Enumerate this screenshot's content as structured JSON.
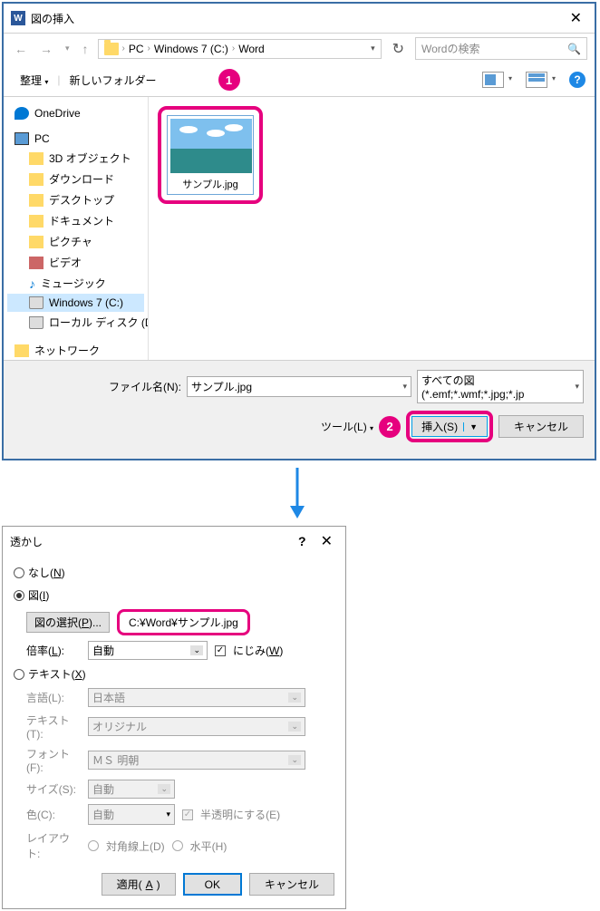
{
  "dialog1": {
    "title": "図の挿入",
    "breadcrumb": [
      "PC",
      "Windows 7 (C:)",
      "Word"
    ],
    "search_placeholder": "Wordの検索",
    "toolbar": {
      "organize": "整理",
      "newfolder": "新しいフォルダー"
    },
    "tree": [
      {
        "label": "OneDrive",
        "icon": "onedrive",
        "level": 1
      },
      {
        "label": "PC",
        "icon": "pc",
        "level": 1
      },
      {
        "label": "3D オブジェクト",
        "icon": "generic",
        "level": 2
      },
      {
        "label": "ダウンロード",
        "icon": "generic",
        "level": 2
      },
      {
        "label": "デスクトップ",
        "icon": "generic",
        "level": 2
      },
      {
        "label": "ドキュメント",
        "icon": "generic",
        "level": 2
      },
      {
        "label": "ピクチャ",
        "icon": "generic",
        "level": 2
      },
      {
        "label": "ビデオ",
        "icon": "video",
        "level": 2
      },
      {
        "label": "ミュージック",
        "icon": "music",
        "level": 2
      },
      {
        "label": "Windows 7 (C:)",
        "icon": "drive",
        "level": 2,
        "selected": true
      },
      {
        "label": "ローカル ディスク (D",
        "icon": "drive",
        "level": 2
      },
      {
        "label": "ネットワーク",
        "icon": "generic",
        "level": 1
      }
    ],
    "file": {
      "name": "サンプル.jpg"
    },
    "filename_label": "ファイル名(N):",
    "filename_value": "サンプル.jpg",
    "filter": "すべての図 (*.emf;*.wmf;*.jpg;*.jp",
    "tools_label": "ツール(L)",
    "insert_label": "挿入(S)",
    "cancel_label": "キャンセル",
    "badges": {
      "one": "1",
      "two": "2"
    }
  },
  "dialog2": {
    "title": "透かし",
    "opt_none": "なし(N)",
    "opt_picture": "図(I)",
    "select_picture": "図の選択(P)...",
    "picture_path": "C:¥Word¥サンプル.jpg",
    "scale_label": "倍率(L):",
    "scale_value": "自動",
    "washout_label": "にじみ(W)",
    "opt_text": "テキスト(X)",
    "lang_label": "言語(L):",
    "lang_value": "日本語",
    "text_label": "テキスト(T):",
    "text_value": "オリジナル",
    "font_label": "フォント(F):",
    "font_value": "ＭＳ 明朝",
    "size_label": "サイズ(S):",
    "size_value": "自動",
    "color_label": "色(C):",
    "color_value": "自動",
    "semitrans_label": "半透明にする(E)",
    "layout_label": "レイアウト:",
    "layout_diag": "対角線上(D)",
    "layout_horiz": "水平(H)",
    "apply": "適用(A)",
    "ok": "OK",
    "cancel": "キャンセル"
  }
}
